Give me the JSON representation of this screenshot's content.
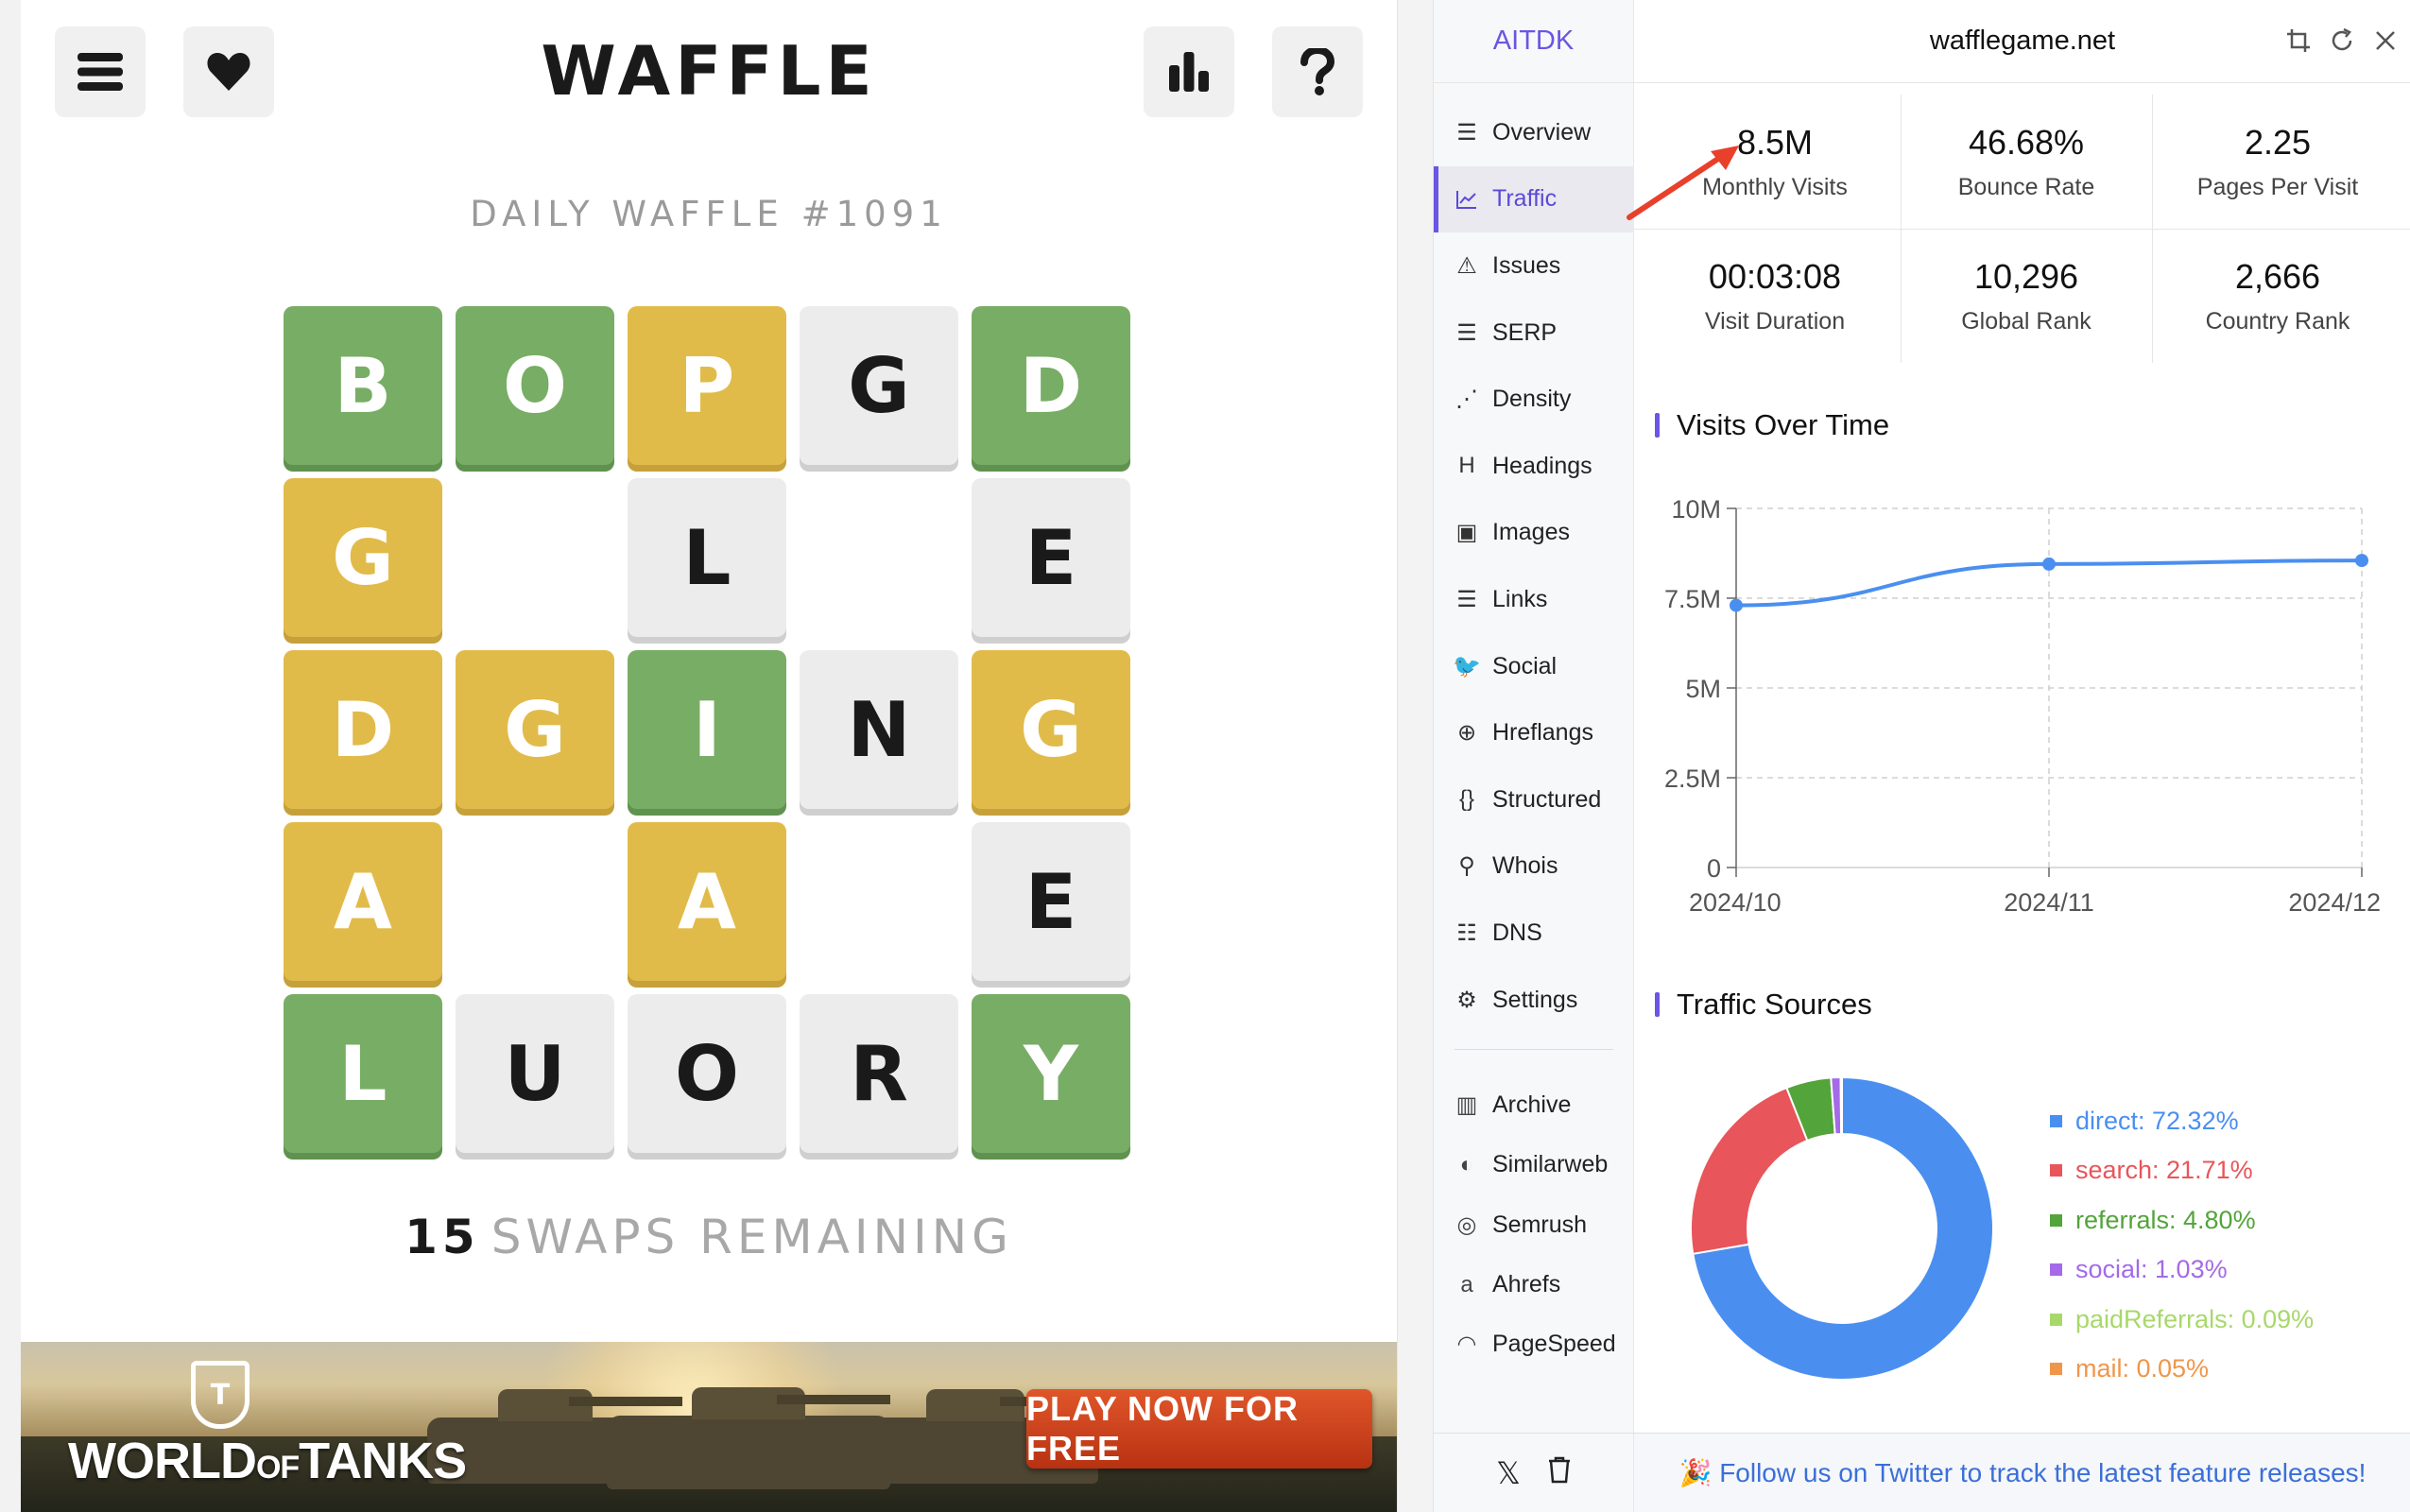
{
  "game": {
    "title": "WAFFLE",
    "daily": "DAILY WAFFLE #1091",
    "swaps_count": "15",
    "swaps_text": "SWAPS REMAINING",
    "grid": [
      [
        "B",
        "O",
        "P",
        "G",
        "D"
      ],
      [
        "G",
        "",
        "L",
        "",
        "E"
      ],
      [
        "D",
        "G",
        "I",
        "N",
        "G"
      ],
      [
        "A",
        "",
        "A",
        "",
        "E"
      ],
      [
        "L",
        "U",
        "O",
        "R",
        "Y"
      ]
    ],
    "tile_states": [
      [
        "green",
        "green",
        "yellow",
        "gray",
        "green"
      ],
      [
        "yellow",
        "",
        "gray",
        "",
        "gray"
      ],
      [
        "yellow",
        "yellow",
        "green",
        "gray",
        "yellow"
      ],
      [
        "yellow",
        "",
        "yellow",
        "",
        "gray"
      ],
      [
        "green",
        "gray",
        "gray",
        "gray",
        "green"
      ]
    ],
    "colors": {
      "green": "#78ad65",
      "yellow": "#e1bb4a",
      "gray": "#ececec"
    },
    "icons": {
      "menu": "hamburger-icon",
      "favorite": "heart-icon",
      "stats": "bar-chart-icon",
      "help": "question-icon"
    }
  },
  "ad": {
    "logo_text": "WORLD OF TANKS",
    "logo_line1": "WORLD",
    "logo_line2": "OF",
    "logo_line3": "TANKS",
    "cta": "PLAY NOW FOR FREE"
  },
  "panel": {
    "brand": "AITDK",
    "site": "wafflegame.net",
    "nav": [
      {
        "label": "Overview",
        "icon": "overview-icon"
      },
      {
        "label": "Traffic",
        "icon": "traffic-chart-icon",
        "active": true
      },
      {
        "label": "Issues",
        "icon": "warning-icon"
      },
      {
        "label": "SERP",
        "icon": "serp-icon"
      },
      {
        "label": "Density",
        "icon": "density-icon"
      },
      {
        "label": "Headings",
        "icon": "heading-icon"
      },
      {
        "label": "Images",
        "icon": "image-icon"
      },
      {
        "label": "Links",
        "icon": "links-list-icon"
      },
      {
        "label": "Social",
        "icon": "twitter-bird-icon"
      },
      {
        "label": "Hreflangs",
        "icon": "globe-icon"
      },
      {
        "label": "Structured",
        "icon": "braces-icon"
      },
      {
        "label": "Whois",
        "icon": "user-search-icon"
      },
      {
        "label": "DNS",
        "icon": "server-icon"
      },
      {
        "label": "Settings",
        "icon": "gear-icon"
      }
    ],
    "external": [
      {
        "label": "Archive",
        "icon": "archive-icon"
      },
      {
        "label": "Similarweb",
        "icon": "similarweb-icon"
      },
      {
        "label": "Semrush",
        "icon": "semrush-icon"
      },
      {
        "label": "Ahrefs",
        "icon": "amazon-a-icon"
      },
      {
        "label": "PageSpeed",
        "icon": "speedometer-icon"
      }
    ],
    "stats": [
      {
        "value": "8.5M",
        "label": "Monthly Visits"
      },
      {
        "value": "46.68%",
        "label": "Bounce Rate"
      },
      {
        "value": "2.25",
        "label": "Pages Per Visit"
      },
      {
        "value": "00:03:08",
        "label": "Visit Duration"
      },
      {
        "value": "10,296",
        "label": "Global Rank"
      },
      {
        "value": "2,666",
        "label": "Country Rank"
      }
    ],
    "visits_title": "Visits Over Time",
    "sources_title": "Traffic Sources",
    "footer_text": "🎉 Follow us on Twitter to track the latest feature releases!",
    "header_icons": [
      "crop-icon",
      "refresh-icon",
      "close-icon"
    ],
    "footer_icons": [
      "x-logo-icon",
      "trash-icon"
    ]
  },
  "chart_data": [
    {
      "type": "line",
      "title": "Visits Over Time",
      "x": [
        "2024/10",
        "2024/11",
        "2024/12"
      ],
      "values": [
        7.3,
        8.45,
        8.55
      ],
      "unit": "M",
      "y_ticks": [
        "0",
        "2.5M",
        "5M",
        "7.5M",
        "10M"
      ],
      "ylim": [
        0,
        10
      ],
      "grid": true,
      "color": "#4a8ff0"
    },
    {
      "type": "pie",
      "title": "Traffic Sources",
      "labels": [
        "direct",
        "search",
        "referrals",
        "social",
        "paidReferrals",
        "mail"
      ],
      "legend_labels": [
        "direct: 72.32%",
        "search: 21.71%",
        "referrals: 4.80%",
        "social: 1.03%",
        "paidReferrals: 0.09%",
        "mail: 0.05%"
      ],
      "values": [
        72.32,
        21.71,
        4.8,
        1.03,
        0.09,
        0.05
      ],
      "colors": [
        "#4a8ff0",
        "#e8555a",
        "#53a43a",
        "#a46ae8",
        "#a8d86a",
        "#f0964a"
      ],
      "donut": true,
      "legend": "right"
    }
  ]
}
